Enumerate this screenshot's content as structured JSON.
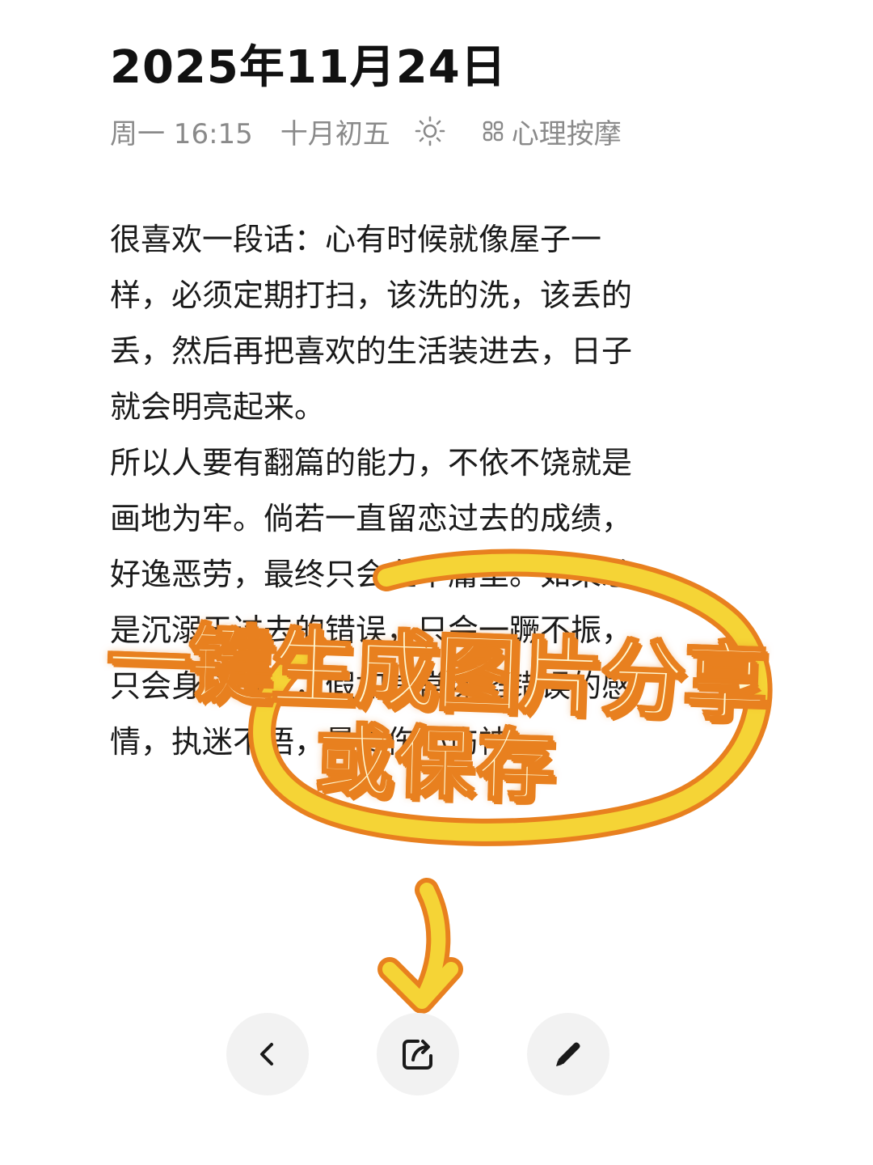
{
  "header": {
    "date_title": "2025年11月24日",
    "weekday_time": "周一 16:15",
    "lunar_date": "十月初五",
    "weather_icon": "sun-icon",
    "category_icon": "grid-icon",
    "category": "心理按摩"
  },
  "content": {
    "lines": [
      "很喜欢一段话：心有时候就像屋子一",
      "样，必须定期打扫，该洗的洗，该丢的",
      "丢，然后再把喜欢的生活装进去，日子",
      "就会明亮起来。",
      "所以人要有翻篇的能力，不依不饶就是",
      "画地为牢。倘若一直留恋过去的成绩，",
      "好逸恶劳，最终只会在平庸里。如果总",
      "是沉溺于过去的错误，只会一蹶不振，",
      "只会身心俱疲，假如常常深陷错误的感",
      "情，执迷不悟，最终伤心伤神。"
    ]
  },
  "overlay": {
    "line1": "一键生成图片分享",
    "line2": "或保存",
    "accent_color": "#e8801f",
    "highlight_color": "#fff7d1",
    "ring_color": "#f5d436"
  },
  "toolbar": {
    "back_icon": "chevron-left-icon",
    "share_icon": "share-icon",
    "edit_icon": "pencil-icon"
  }
}
